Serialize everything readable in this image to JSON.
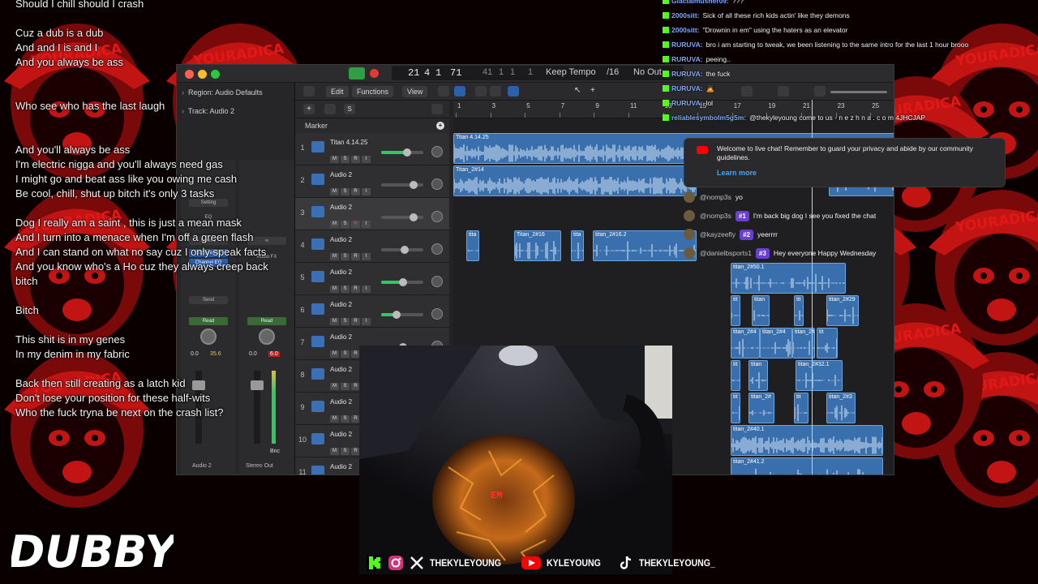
{
  "lyrics": [
    "Should I chill should I crash",
    "",
    "Cuz a dub is a dub",
    "And and I is and I",
    "And you always be ass",
    "",
    "",
    "Who see who has the last laugh",
    "",
    "",
    "And you'll always be ass",
    "I'm electric nigga and you'll always need gas",
    "I might go and beat ass like you owing me cash",
    "Be cool, chill, shut up bitch it's only 3 tasks",
    "",
    "Dog I really am a saint , this is just a mean mask",
    "And I turn into a menace when I'm off a green flash",
    "And I can stand on what no say cuz I only speak facts",
    "And you know who's a Ho cuz they always creep back",
    "bitch",
    "",
    "Bitch",
    "",
    "This shit is in my genes",
    "In my denim in my fabric",
    "",
    "Back then still creating as a latch kid",
    "Don't lose your position for  these half-wits",
    "Who the fuck tryna be next on the crash list?"
  ],
  "background": {
    "brand_text": "YOURADICA",
    "colors": {
      "base": "#7a0a0a",
      "face": "#c31414",
      "dark": "#1a0000"
    }
  },
  "daw": {
    "transport": {
      "bar": "21",
      "beat": "4",
      "div": "1",
      "tick": "71",
      "end_bar": "41",
      "end_beat": "1",
      "end_div": "1",
      "end_tick": "1",
      "mode": "Keep Tempo",
      "time_sig": "/16",
      "output": "No Out"
    },
    "inspector": {
      "region_label": "Region:",
      "region_value": "Audio Defaults",
      "track_label": "Track:",
      "track_value": "Audio 2",
      "setting": "Setting",
      "eq": "EQ",
      "input": "Input 1",
      "compressor": "Compressor",
      "channel_eq": "Channel EQ",
      "audio_fx": "Audio FX",
      "send": "Send",
      "stereo_out": "Stereo Out",
      "read": "Read",
      "read2": "Read",
      "vol_left": "0.0",
      "vol_left_peak": "35.6",
      "vol_right": "0.0",
      "vol_right_peak": "6.0",
      "bnc": "Bnc",
      "strip_name_left": "Audio 2",
      "strip_name_right": "Stereo Out"
    },
    "toolbar": {
      "edit": "Edit",
      "functions": "Functions",
      "view": "View"
    },
    "marker_label": "Marker",
    "ruler_ticks": [
      "1",
      "3",
      "5",
      "7",
      "9",
      "11",
      "13",
      "15",
      "17",
      "19",
      "21",
      "23",
      "25"
    ],
    "tracks": [
      {
        "num": "1",
        "name": "Titan 4.14.25",
        "selected": false,
        "fader": 0.6,
        "green": true
      },
      {
        "num": "2",
        "name": "Audio 2",
        "selected": false,
        "fader": 0.75,
        "green": false
      },
      {
        "num": "3",
        "name": "Audio 2",
        "selected": true,
        "fader": 0.75,
        "green": false,
        "rec": true
      },
      {
        "num": "4",
        "name": "Audio 2",
        "selected": false,
        "fader": 0.55,
        "green": false
      },
      {
        "num": "5",
        "name": "Audio 2",
        "selected": false,
        "fader": 0.5,
        "green": true
      },
      {
        "num": "6",
        "name": "Audio 2",
        "selected": false,
        "fader": 0.35,
        "green": true
      },
      {
        "num": "7",
        "name": "Audio 2",
        "selected": false,
        "fader": 0.5,
        "green": false
      },
      {
        "num": "8",
        "name": "Audio 2",
        "selected": false,
        "fader": 0.5,
        "green": false
      },
      {
        "num": "9",
        "name": "Audio 2",
        "selected": false,
        "fader": 0.5,
        "green": false
      },
      {
        "num": "10",
        "name": "Audio 2",
        "selected": false,
        "fader": 0.5,
        "green": false
      },
      {
        "num": "11",
        "name": "Audio 2",
        "selected": false,
        "fader": 0.5,
        "green": false
      }
    ],
    "region_labels": [
      "Titan 4.14.25",
      "Titan_2#14",
      "tita",
      "Titan_2#16",
      "tita",
      "titan_2#16.2",
      "titan_2#50.1",
      "tit",
      "titan",
      "tit",
      "titan_2#29",
      "titan_2#4",
      "titan_2#4",
      "titan_2#4",
      "tit",
      "tit",
      "titan",
      "titan_2#32.1",
      "tit",
      "titan_2#",
      "tit",
      "titan_2#3",
      "titan_2#40.1",
      "titan_2#41.2"
    ]
  },
  "chat": {
    "kick": [
      {
        "user": "Glacialmusher09:",
        "text": "???"
      },
      {
        "user": "2000sitt:",
        "text": "Sick of all these rich kids actin' like they demons"
      },
      {
        "user": "2000sitt:",
        "text": "\"Drownin in em\" using the haters as an elevator"
      },
      {
        "user": "RURUVA:",
        "text": "bro i am starting to tweak, we been listening to the same intro for the last 1 hour brooo"
      },
      {
        "user": "RURUVA:",
        "text": "peeing.."
      },
      {
        "user": "RURUVA:",
        "text": "the fuck"
      },
      {
        "user": "RURUVA:",
        "text": "🙇"
      },
      {
        "user": "RURUVA:",
        "text": "lol"
      },
      {
        "user": "reliablesymbolm5g5m:",
        "text": "@thekyleyoung come to us - n e z h n a . c o m 4JHCJAP"
      }
    ],
    "youtube_notice": {
      "text": "Welcome to live chat! Remember to guard your privacy and abide by our community guidelines.",
      "link": "Learn more"
    },
    "youtube": [
      {
        "handle": "@nomp3s",
        "badge": "",
        "text": "yo"
      },
      {
        "handle": "@nomp3s",
        "badge": "#1",
        "text": "I'm back big dog I see you fixed the chat"
      },
      {
        "handle": "@kayzeefly",
        "badge": "#2",
        "text": "yeerrrr"
      },
      {
        "handle": "@danielbsports1",
        "badge": "#3",
        "text": "Hey everyone Happy Wednesday"
      }
    ]
  },
  "camera": {
    "label": "EM"
  },
  "socials": [
    {
      "icon": "kick-icon",
      "label": ""
    },
    {
      "icon": "instagram-icon",
      "label": ""
    },
    {
      "icon": "x-icon",
      "label": "THEKYLEYOUNG"
    },
    {
      "icon": "youtube-icon",
      "label": "KYLEYOUNG"
    },
    {
      "icon": "tiktok-icon",
      "label": "THEKYLEYOUNG_"
    }
  ],
  "logo": {
    "text": "DUBBY"
  }
}
